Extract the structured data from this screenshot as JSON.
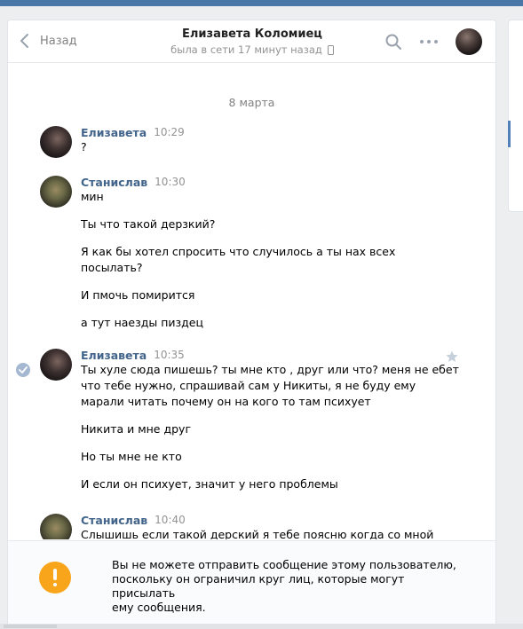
{
  "header": {
    "back_label": "Назад",
    "peer_name": "Елизавета Коломиец",
    "peer_status": "была в сети 17 минут назад"
  },
  "history": {
    "date_separator": "8 марта",
    "messages": [
      {
        "author": "Елизавета",
        "time": "10:29",
        "lines": [
          "?"
        ]
      },
      {
        "author": "Станислав",
        "time": "10:30",
        "lines": [
          "мин",
          "Ты что такой дерзкий?",
          "Я как бы хотел спросить что случилось а ты нах всех",
          "посылать?",
          "И пмочь помирится",
          "а тут наезды пиздец"
        ]
      },
      {
        "author": "Елизавета",
        "time": "10:35",
        "lines": [
          "Ты хуле сюда пишешь? ты мне кто , друг или что? меня не ебет",
          "что тебе нужно, спрашивай сам у Никиты, я не буду ему",
          "марали читать почему он на кого то там психует",
          "Никита и мне друг",
          "Но ты мне не кто",
          "И если он психует, значит у него проблемы"
        ]
      },
      {
        "author": "Станислав",
        "time": "10:40",
        "lines": [
          "Слышишь если такой дерский я тебе поясню когда со мной"
        ]
      }
    ]
  },
  "notice": {
    "lines": [
      "Вы не можете отправить сообщение этому пользователю,",
      "поскольку он ограничил круг лиц, которые могут присылать",
      "ему сообщения."
    ]
  },
  "colors": {
    "accent": "#4a76a8",
    "author_link": "#42648b",
    "warning": "#f8a51b"
  },
  "icons": [
    "chevron-left-icon",
    "phone-icon",
    "search-icon",
    "more-icon",
    "check-icon",
    "star-icon",
    "exclamation-icon"
  ]
}
